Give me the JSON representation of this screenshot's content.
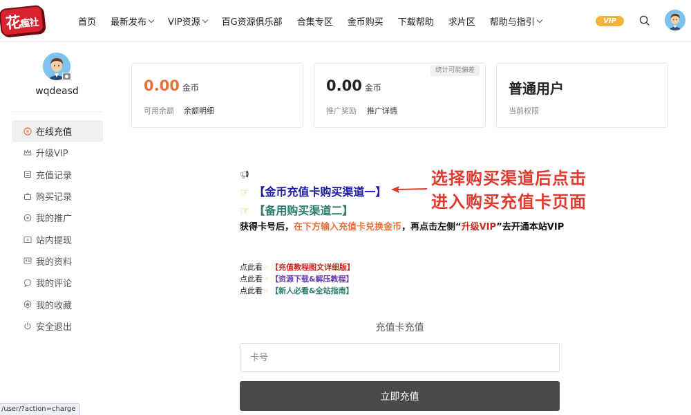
{
  "header": {
    "logo_text_1": "花",
    "logo_text_2": "瘋社",
    "nav": [
      {
        "label": "首页",
        "dropdown": false
      },
      {
        "label": "最新发布",
        "dropdown": true
      },
      {
        "label": "VIP资源",
        "dropdown": true
      },
      {
        "label": "百G资源俱乐部",
        "dropdown": false
      },
      {
        "label": "合集专区",
        "dropdown": false
      },
      {
        "label": "金币购买",
        "dropdown": false
      },
      {
        "label": "下载帮助",
        "dropdown": false
      },
      {
        "label": "求片区",
        "dropdown": false
      },
      {
        "label": "帮助与指引",
        "dropdown": true
      }
    ],
    "vip_badge": "VIP",
    "vip_color": "#f2b43a"
  },
  "sidebar": {
    "username": "wqdeasd",
    "items": [
      {
        "label": "在线充值",
        "icon": "coin-icon",
        "active": true
      },
      {
        "label": "升级VIP",
        "icon": "crown-icon",
        "active": false
      },
      {
        "label": "充值记录",
        "icon": "list-icon",
        "active": false
      },
      {
        "label": "购买记录",
        "icon": "bag-icon",
        "active": false
      },
      {
        "label": "我的推广",
        "icon": "share-icon",
        "active": false
      },
      {
        "label": "站内提现",
        "icon": "wallet-icon",
        "active": false
      },
      {
        "label": "我的资料",
        "icon": "id-card-icon",
        "active": false
      },
      {
        "label": "我的评论",
        "icon": "comment-icon",
        "active": false
      },
      {
        "label": "我的收藏",
        "icon": "star-icon",
        "active": false
      },
      {
        "label": "安全退出",
        "icon": "power-icon",
        "active": false
      }
    ]
  },
  "cards": {
    "balance": {
      "value": "0.00",
      "unit": "金币",
      "label": "可用余额",
      "link": "余额明细"
    },
    "promo": {
      "value": "0.00",
      "unit": "金币",
      "label": "推广奖励",
      "link": "推广详情",
      "tag": "统计可能偏差"
    },
    "role": {
      "value": "普通用户",
      "label": "当前权限"
    }
  },
  "announcement": {
    "channel1": "【金币充值卡购买渠道一】",
    "channel2": "【备用购买渠道二】",
    "instr_a": "获得卡号后，",
    "instr_b": "在下方输入充值卡兑换金币",
    "instr_c": "，再点击左侧“",
    "instr_d": "升级VIP",
    "instr_e": "”去开通本站VIP",
    "see_prefix": "点此看",
    "link1": "【充值教程图文详细版】",
    "link2": "【资源下载&解压教程】",
    "link3": "【新人必看&全站指南】"
  },
  "annotation": {
    "line1": "选择购买渠道后点击",
    "line2": "进入购买充值卡页面",
    "color": "#e03a2e"
  },
  "charge": {
    "title": "充值卡充值",
    "placeholder": "卡号",
    "button": "立即充值"
  },
  "status_url": "/user/?action=charge"
}
